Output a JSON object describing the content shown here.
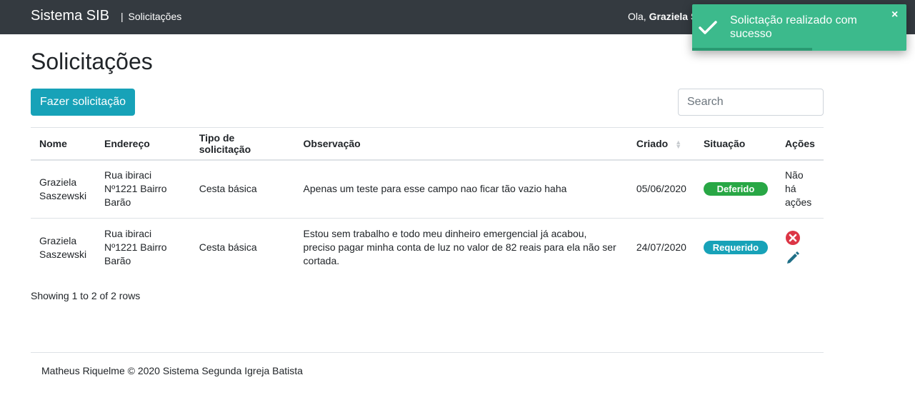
{
  "navbar": {
    "brand": "Sistema SIB",
    "separator": "|",
    "section": "Solicitações",
    "greeting_prefix": "Ola,",
    "user_name": "Graziela S"
  },
  "page": {
    "title": "Solicitações",
    "new_request_button": "Fazer solicitação"
  },
  "search": {
    "placeholder": "Search",
    "value": ""
  },
  "table": {
    "headers": {
      "nome": "Nome",
      "endereco": "Endereço",
      "tipo": "Tipo de solicitação",
      "observacao": "Observação",
      "criado": "Criado",
      "situacao": "Situação",
      "acoes": "Ações"
    },
    "rows": [
      {
        "nome": "Graziela Saszewski",
        "endereco": "Rua ibiraci Nº1221 Bairro Barão",
        "tipo": "Cesta básica",
        "observacao": "Apenas um teste para esse campo nao ficar tão vazio haha",
        "criado": "05/06/2020",
        "situacao": "Deferido",
        "acoes_text": "Não há ações"
      },
      {
        "nome": "Graziela Saszewski",
        "endereco": "Rua ibiraci Nº1221 Bairro Barão",
        "tipo": "Cesta básica",
        "observacao": "Estou sem trabalho e todo meu dinheiro emergencial já acabou, preciso pagar minha conta de luz no valor de 82 reais para ela não ser cortada.",
        "criado": "24/07/2020",
        "situacao": "Requerido",
        "acoes_icons": [
          "cancel-icon",
          "edit-icon"
        ]
      }
    ]
  },
  "pagination": {
    "info": "Showing 1 to 2 of 2 rows"
  },
  "footer": {
    "text": "Matheus Riquelme © 2020 Sistema Segunda Igreja Batista"
  },
  "toast": {
    "message": "Solictação realizado com sucesso",
    "close": "×",
    "progress": 0.56
  },
  "colors": {
    "navbar": "#343a40",
    "primary": "#17a2b8",
    "success": "#28a745",
    "danger": "#dc3545",
    "toast": "#3cba8c"
  }
}
